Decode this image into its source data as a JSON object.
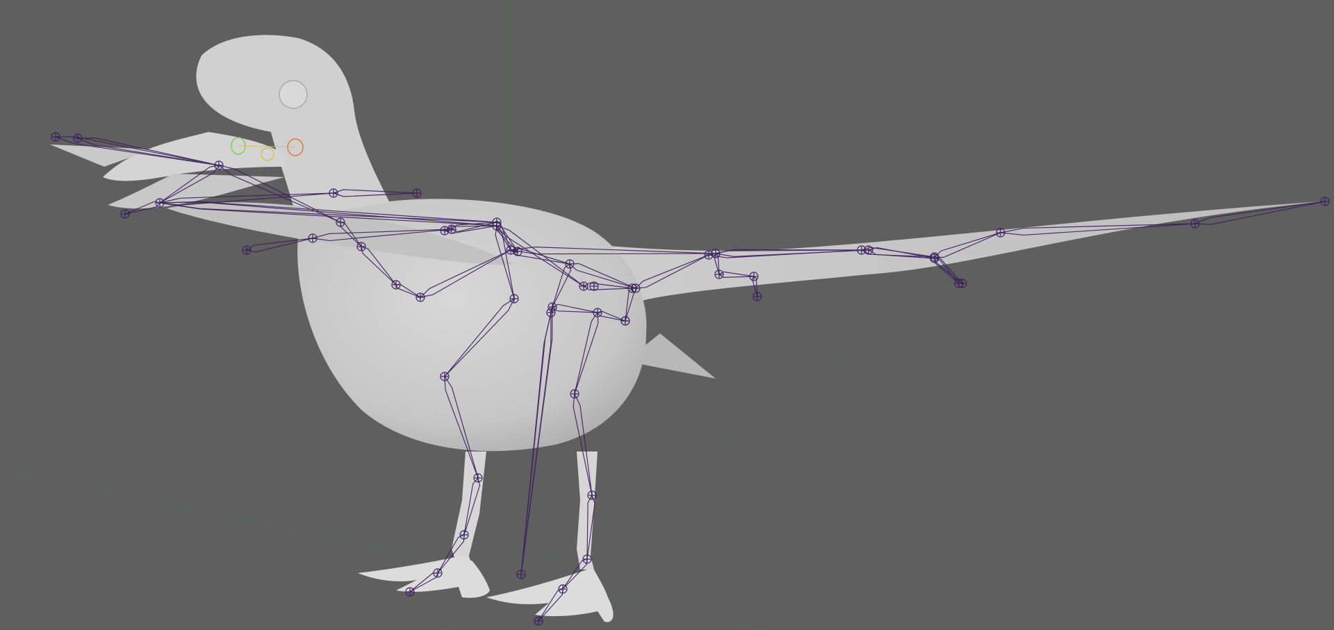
{
  "viewport": {
    "name": "3D viewport",
    "background_color": "#5f5f5f",
    "grid_color": "#4f6e55",
    "mesh_color": "#d2d2d2",
    "mesh_shadow_color": "#b4b4b4",
    "bone_color": "#3a1f5c",
    "selected_locator_color": "#e07a3a",
    "active_locator_color": "#7fcf4a",
    "secondary_locator_color": "#d8c24a"
  },
  "model": {
    "icon": "duck-mesh-icon"
  },
  "rig": {
    "icon": "skeleton-icon",
    "joint_icon": "joint-icon"
  }
}
